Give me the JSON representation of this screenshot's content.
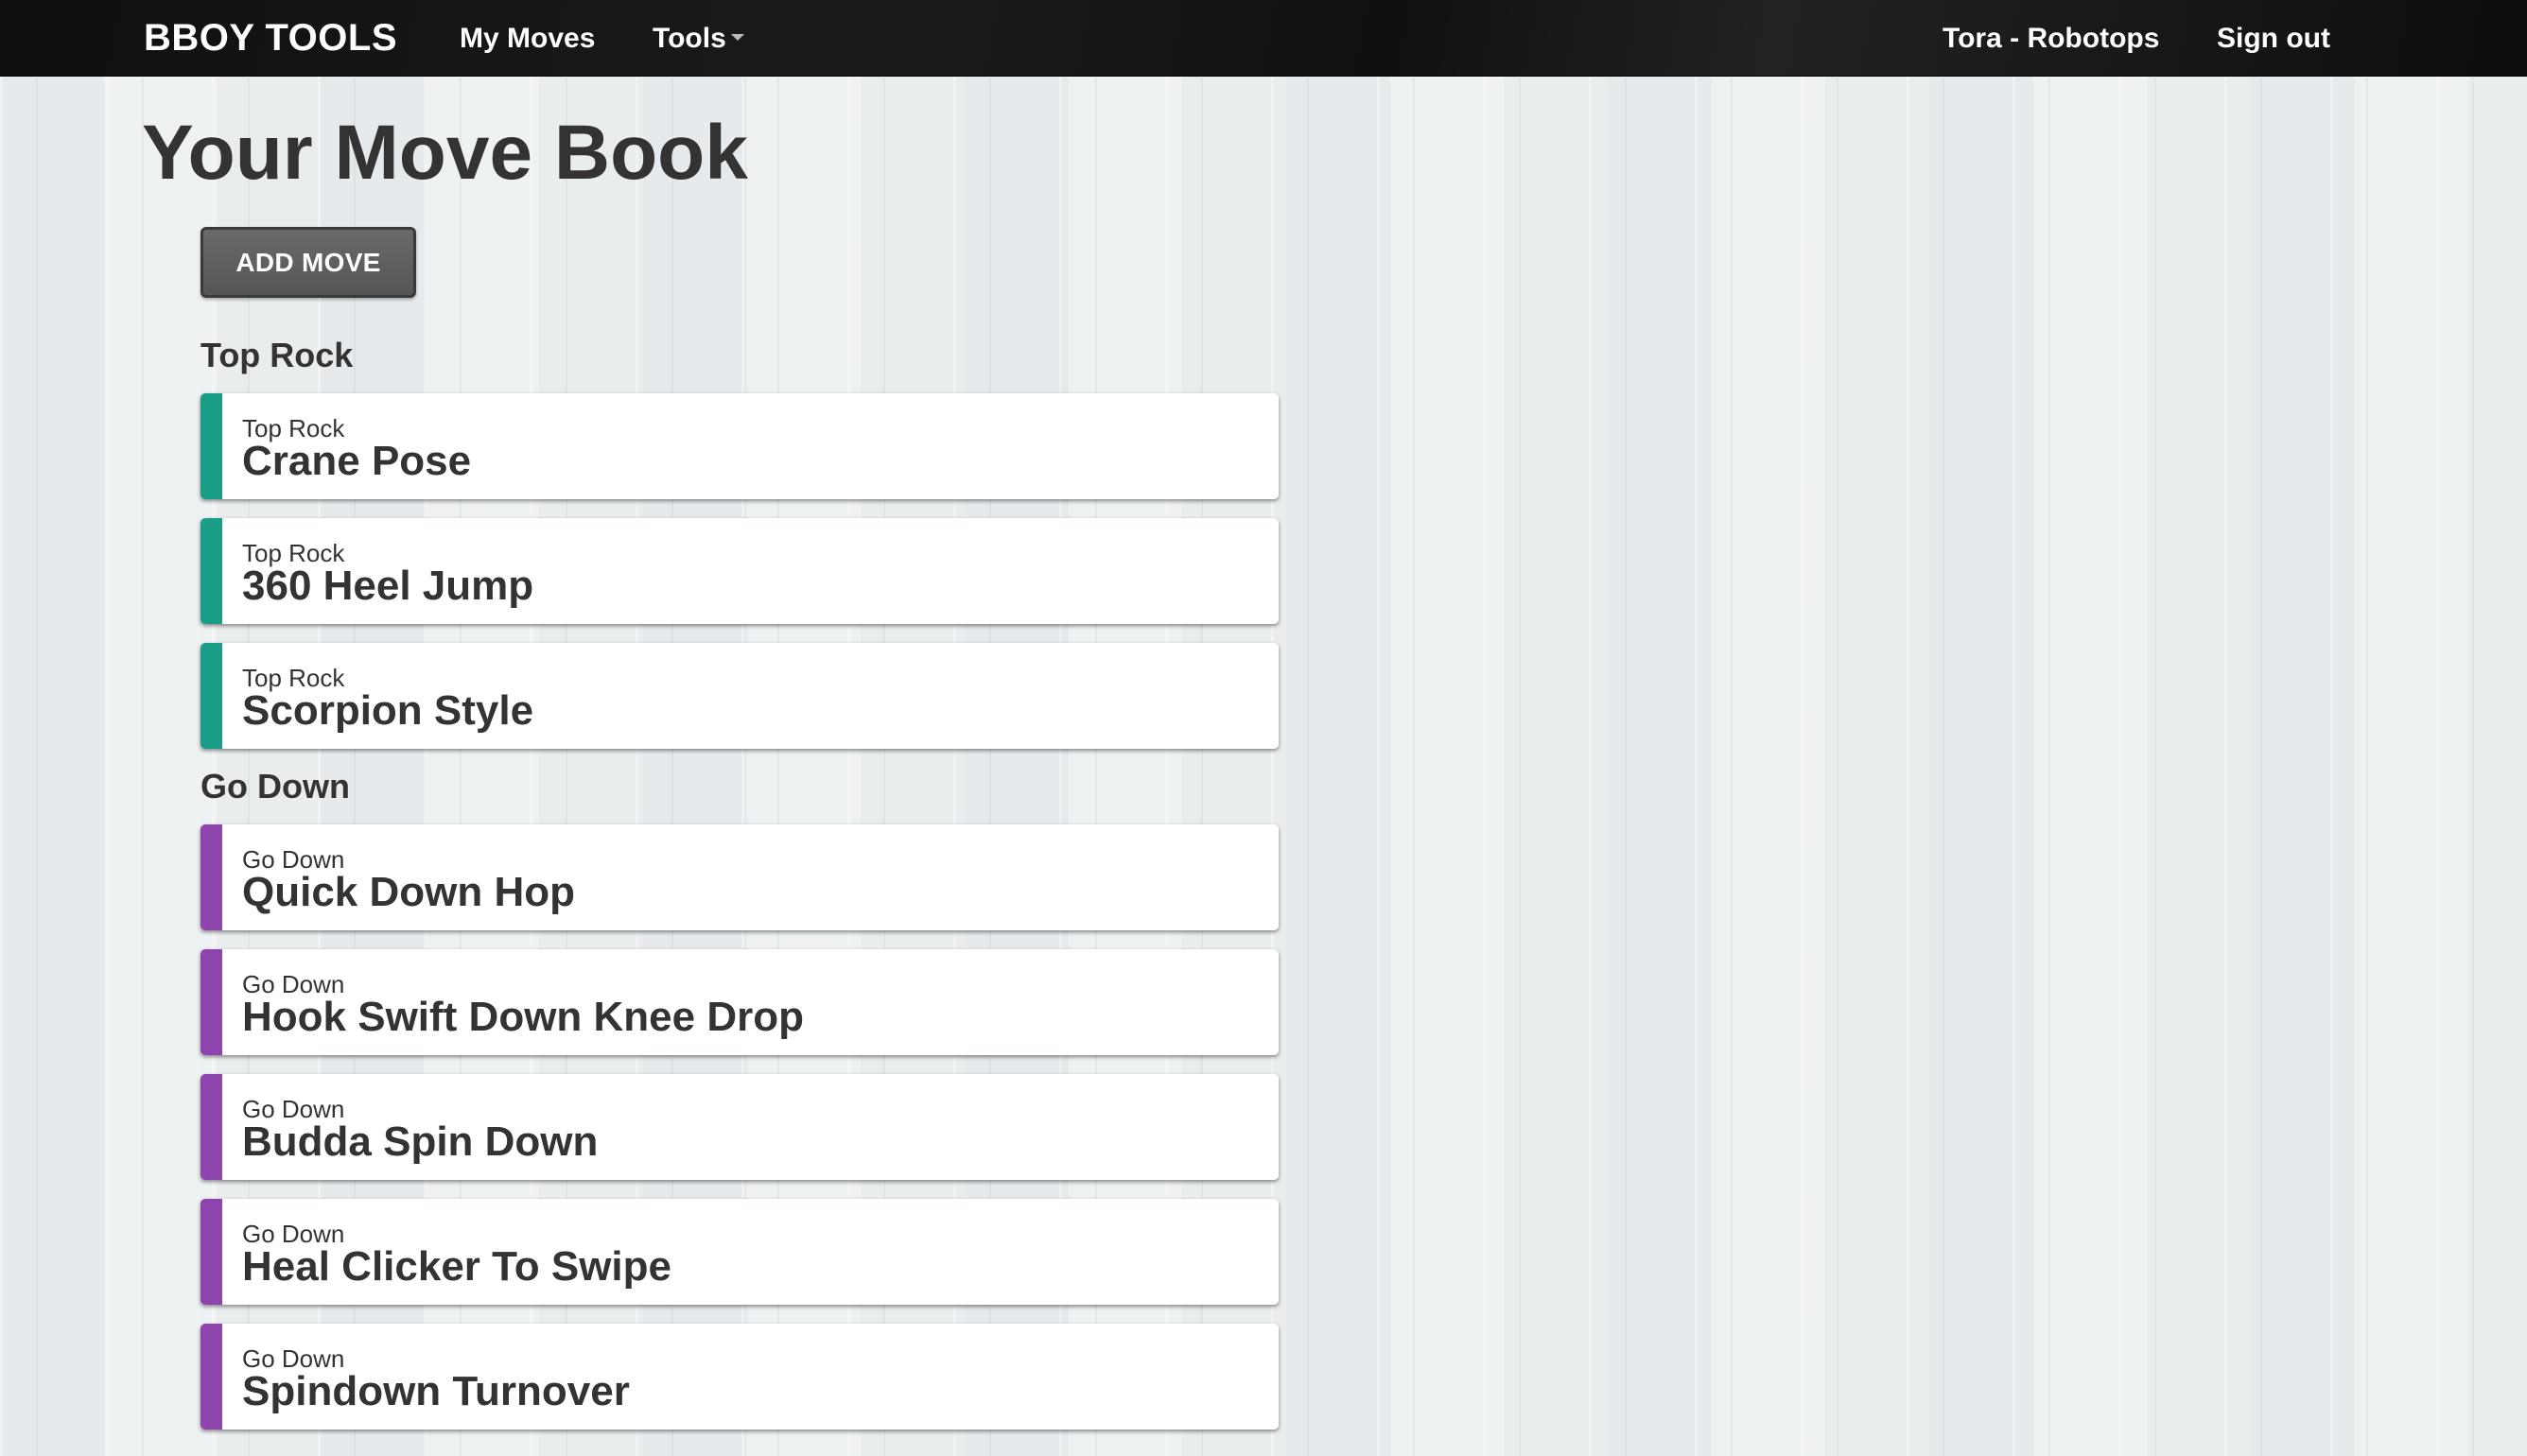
{
  "navbar": {
    "brand": "BBOY TOOLS",
    "my_moves": "My Moves",
    "tools": "Tools",
    "user": "Tora - Robotops",
    "sign_out": "Sign out"
  },
  "page": {
    "title": "Your Move Book",
    "add_move_label": "ADD MOVE"
  },
  "colors": {
    "top_rock_accent": "#1a9e88",
    "go_down_accent": "#8e44ad"
  },
  "sections": [
    {
      "title": "Top Rock",
      "moves": [
        {
          "category": "Top Rock",
          "name": "Crane Pose"
        },
        {
          "category": "Top Rock",
          "name": "360 Heel Jump"
        },
        {
          "category": "Top Rock",
          "name": "Scorpion Style"
        }
      ]
    },
    {
      "title": "Go Down",
      "moves": [
        {
          "category": "Go Down",
          "name": "Quick Down Hop"
        },
        {
          "category": "Go Down",
          "name": "Hook Swift Down Knee Drop"
        },
        {
          "category": "Go Down",
          "name": "Budda Spin Down"
        },
        {
          "category": "Go Down",
          "name": "Heal Clicker To Swipe"
        },
        {
          "category": "Go Down",
          "name": "Spindown Turnover"
        }
      ]
    }
  ]
}
